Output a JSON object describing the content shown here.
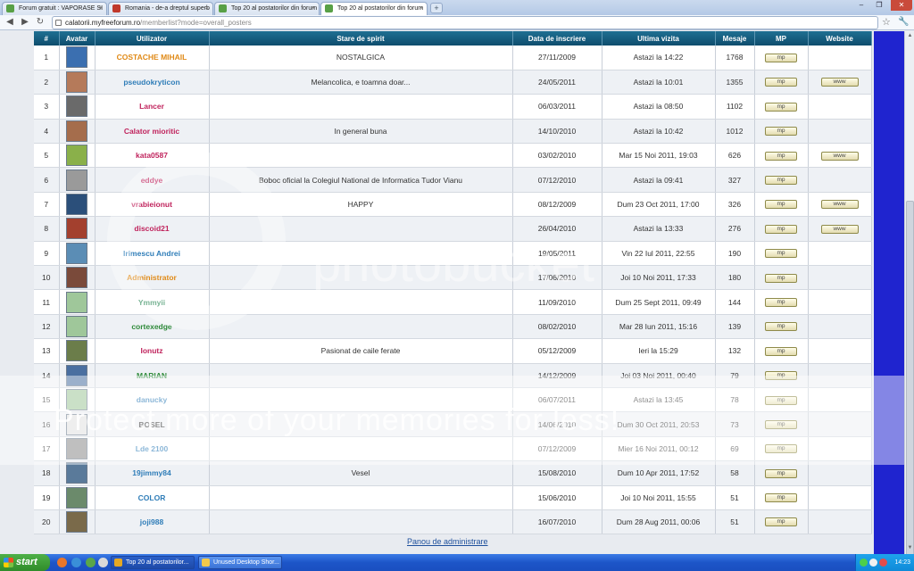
{
  "browser": {
    "tabs": [
      {
        "label": "Forum gratuit : VAPORASE SI",
        "icon_color": "#58a046",
        "active": false
      },
      {
        "label": "Romania - de-a dreptul superb",
        "icon_color": "#c0392b",
        "active": false
      },
      {
        "label": "Top 20 al postatorilor din forum",
        "icon_color": "#58a046",
        "active": false
      },
      {
        "label": "Top 20 al postatorilor din forum",
        "icon_color": "#58a046",
        "active": true
      }
    ],
    "tab_close": "×",
    "new_tab": "+",
    "window_controls": {
      "minimize": "–",
      "maximize": "❐",
      "close": "✕"
    },
    "url_host": "calatorii.myfreeforum.ro",
    "url_path": "/memberlist?mode=overall_posters",
    "back": "◀",
    "forward": "▶",
    "reload": "↻",
    "bookmark_star": "☆",
    "menu_wrench": "🔧"
  },
  "table": {
    "headers": [
      "#",
      "Avatar",
      "Utilizator",
      "Stare de spirit",
      "Data de inscriere",
      "Ultima vizita",
      "Mesaje",
      "MP",
      "Website"
    ],
    "mp_label": "mp",
    "www_label": "www",
    "rows": [
      {
        "rank": "1",
        "user": "COSTACHE MIHAIL",
        "user_color": "#e08a17",
        "mood": "NOSTALGICA",
        "joined": "27/11/2009",
        "last": "Astazi la 14:22",
        "posts": "1768",
        "avatar_color": "#3b6fb0",
        "website": false
      },
      {
        "rank": "2",
        "user": "pseudokryticon",
        "user_color": "#2f7db8",
        "mood": "Melancolica, e toamna doar...",
        "joined": "24/05/2011",
        "last": "Astazi la 10:01",
        "posts": "1355",
        "avatar_color": "#b57a5a",
        "website": true
      },
      {
        "rank": "3",
        "user": "Lancer",
        "user_color": "#c0245d",
        "mood": "",
        "joined": "06/03/2011",
        "last": "Astazi la 08:50",
        "posts": "1102",
        "avatar_color": "#6a6a6a",
        "website": false
      },
      {
        "rank": "4",
        "user": "Calator mioritic",
        "user_color": "#c0245d",
        "mood": "In general buna",
        "joined": "14/10/2010",
        "last": "Astazi la 10:42",
        "posts": "1012",
        "avatar_color": "#a56d4c",
        "website": false
      },
      {
        "rank": "5",
        "user": "kata0587",
        "user_color": "#c0245d",
        "mood": "",
        "joined": "03/02/2010",
        "last": "Mar 15 Noi 2011, 19:03",
        "posts": "626",
        "avatar_color": "#8ab04a",
        "website": true
      },
      {
        "rank": "6",
        "user": "eddye",
        "user_color": "#c0245d",
        "mood": "Boboc oficial la Colegiul National de Informatica Tudor Vianu",
        "joined": "07/12/2010",
        "last": "Astazi la 09:41",
        "posts": "327",
        "avatar_color": "#9a9a9a",
        "website": false
      },
      {
        "rank": "7",
        "user": "vrabieionut",
        "user_color": "#c0245d",
        "mood": "HAPPY",
        "joined": "08/12/2009",
        "last": "Dum 23 Oct 2011, 17:00",
        "posts": "326",
        "avatar_color": "#2b4f7a",
        "website": true
      },
      {
        "rank": "8",
        "user": "discoid21",
        "user_color": "#c0245d",
        "mood": "",
        "joined": "26/04/2010",
        "last": "Astazi la 13:33",
        "posts": "276",
        "avatar_color": "#a3402e",
        "website": true
      },
      {
        "rank": "9",
        "user": "Irimescu Andrei",
        "user_color": "#2f7db8",
        "mood": "",
        "joined": "19/05/2011",
        "last": "Vin 22 Iul 2011, 22:55",
        "posts": "190",
        "avatar_color": "#5b8db5",
        "website": false
      },
      {
        "rank": "10",
        "user": "Administrator",
        "user_color": "#e08a17",
        "mood": "",
        "joined": "17/06/2010",
        "last": "Joi 10 Noi 2011, 17:33",
        "posts": "180",
        "avatar_color": "#7a4a3a",
        "website": false
      },
      {
        "rank": "11",
        "user": "Ymmyii",
        "user_color": "#2f8a5a",
        "mood": "",
        "joined": "11/09/2010",
        "last": "Dum 25 Sept 2011, 09:49",
        "posts": "144",
        "avatar_color": "#9fc79a",
        "website": false
      },
      {
        "rank": "12",
        "user": "cortexedge",
        "user_color": "#2f8a3a",
        "mood": "",
        "joined": "08/02/2010",
        "last": "Mar 28 Iun 2011, 15:16",
        "posts": "139",
        "avatar_color": "#9fc79a",
        "website": false
      },
      {
        "rank": "13",
        "user": "Ionutz",
        "user_color": "#c0245d",
        "mood": "Pasionat de caile ferate",
        "joined": "05/12/2009",
        "last": "Ieri la 15:29",
        "posts": "132",
        "avatar_color": "#6b7d4a",
        "website": false
      },
      {
        "rank": "14",
        "user": "MARIAN",
        "user_color": "#2f8a3a",
        "mood": "",
        "joined": "14/12/2009",
        "last": "Joi 03 Noi 2011, 00:40",
        "posts": "79",
        "avatar_color": "#4a6fa0",
        "website": false
      },
      {
        "rank": "15",
        "user": "danucky",
        "user_color": "#2f7db8",
        "mood": "",
        "joined": "06/07/2011",
        "last": "Astazi la 13:45",
        "posts": "78",
        "avatar_color": "#9fc79a",
        "website": false
      },
      {
        "rank": "16",
        "user": "BOSEL",
        "user_color": "#333333",
        "mood": "",
        "joined": "14/06/2010",
        "last": "Dum 30 Oct 2011, 20:53",
        "posts": "73",
        "avatar_color": "#e0e0e0",
        "website": false
      },
      {
        "rank": "17",
        "user": "Lde 2100",
        "user_color": "#2f7db8",
        "mood": "",
        "joined": "07/12/2009",
        "last": "Mier 16 Noi 2011, 00:12",
        "posts": "69",
        "avatar_color": "#8a8a8a",
        "website": false
      },
      {
        "rank": "18",
        "user": "19jimmy84",
        "user_color": "#2f7db8",
        "mood": "Vesel",
        "joined": "15/08/2010",
        "last": "Dum 10 Apr 2011, 17:52",
        "posts": "58",
        "avatar_color": "#5a7a9a",
        "website": false
      },
      {
        "rank": "19",
        "user": "COLOR",
        "user_color": "#2f7db8",
        "mood": "",
        "joined": "15/06/2010",
        "last": "Joi 10 Noi 2011, 15:55",
        "posts": "51",
        "avatar_color": "#6b8a6b",
        "website": false
      },
      {
        "rank": "20",
        "user": "joji988",
        "user_color": "#2f7db8",
        "mood": "",
        "joined": "16/07/2010",
        "last": "Dum 28 Aug 2011, 00:06",
        "posts": "51",
        "avatar_color": "#7a6a4a",
        "website": false
      }
    ]
  },
  "footer": {
    "admin_link": "Panou de administrare"
  },
  "watermark": {
    "text": "Protect more of your memories for less!",
    "brand": "photobucket"
  },
  "taskbar": {
    "start": "start",
    "buttons": [
      {
        "label": "Top 20 al postatorilor...",
        "icon_color": "#e5a823",
        "active": true
      },
      {
        "label": "Unused Desktop Shor...",
        "icon_color": "#f2c94c",
        "active": false
      }
    ],
    "clock": "14:23"
  }
}
